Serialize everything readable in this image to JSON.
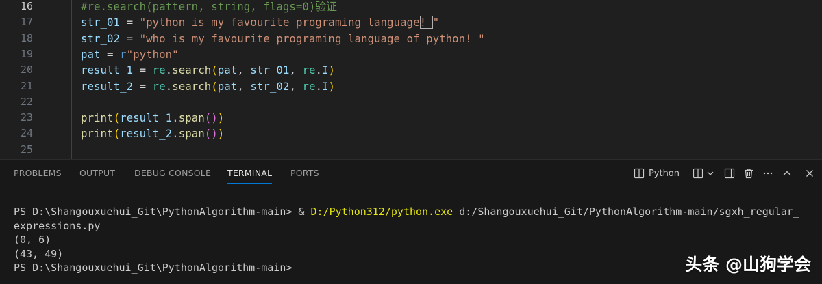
{
  "editor": {
    "lines": [
      {
        "num": "16",
        "active": true,
        "tokens": [
          {
            "t": "#re.search(pattern, string, flags=0)验证",
            "c": "c-com"
          }
        ]
      },
      {
        "num": "17",
        "tokens": [
          {
            "t": "str_01",
            "c": "c-var"
          },
          {
            "t": " = ",
            "c": "c-op"
          },
          {
            "t": "\"python is my favourite programing language",
            "c": "c-str"
          },
          {
            "t": "! ",
            "c": "c-str",
            "box": true
          },
          {
            "t": "\"",
            "c": "c-str"
          }
        ]
      },
      {
        "num": "18",
        "tokens": [
          {
            "t": "str_02",
            "c": "c-var"
          },
          {
            "t": " = ",
            "c": "c-op"
          },
          {
            "t": "\"who is my favourite programing language of python! \"",
            "c": "c-str"
          }
        ]
      },
      {
        "num": "19",
        "tokens": [
          {
            "t": "pat",
            "c": "c-var"
          },
          {
            "t": " = ",
            "c": "c-op"
          },
          {
            "t": "r",
            "c": "c-kw"
          },
          {
            "t": "\"python\"",
            "c": "c-str"
          }
        ]
      },
      {
        "num": "20",
        "tokens": [
          {
            "t": "result_1",
            "c": "c-var"
          },
          {
            "t": " = ",
            "c": "c-op"
          },
          {
            "t": "re",
            "c": "c-mod"
          },
          {
            "t": ".",
            "c": "c-op"
          },
          {
            "t": "search",
            "c": "c-fn"
          },
          {
            "t": "(",
            "c": "c-b3"
          },
          {
            "t": "pat",
            "c": "c-var"
          },
          {
            "t": ", ",
            "c": "c-op"
          },
          {
            "t": "str_01",
            "c": "c-var"
          },
          {
            "t": ", ",
            "c": "c-op"
          },
          {
            "t": "re",
            "c": "c-mod"
          },
          {
            "t": ".",
            "c": "c-op"
          },
          {
            "t": "I",
            "c": "c-var"
          },
          {
            "t": ")",
            "c": "c-b3"
          }
        ]
      },
      {
        "num": "21",
        "tokens": [
          {
            "t": "result_2",
            "c": "c-var"
          },
          {
            "t": " = ",
            "c": "c-op"
          },
          {
            "t": "re",
            "c": "c-mod"
          },
          {
            "t": ".",
            "c": "c-op"
          },
          {
            "t": "search",
            "c": "c-fn"
          },
          {
            "t": "(",
            "c": "c-b3"
          },
          {
            "t": "pat",
            "c": "c-var"
          },
          {
            "t": ", ",
            "c": "c-op"
          },
          {
            "t": "str_02",
            "c": "c-var"
          },
          {
            "t": ", ",
            "c": "c-op"
          },
          {
            "t": "re",
            "c": "c-mod"
          },
          {
            "t": ".",
            "c": "c-op"
          },
          {
            "t": "I",
            "c": "c-var"
          },
          {
            "t": ")",
            "c": "c-b3"
          }
        ]
      },
      {
        "num": "22",
        "tokens": []
      },
      {
        "num": "23",
        "tokens": [
          {
            "t": "print",
            "c": "c-fn"
          },
          {
            "t": "(",
            "c": "c-b3"
          },
          {
            "t": "result_1",
            "c": "c-var"
          },
          {
            "t": ".",
            "c": "c-op"
          },
          {
            "t": "span",
            "c": "c-fn"
          },
          {
            "t": "()",
            "c": "c-b1"
          },
          {
            "t": ")",
            "c": "c-b3"
          }
        ]
      },
      {
        "num": "24",
        "tokens": [
          {
            "t": "print",
            "c": "c-fn"
          },
          {
            "t": "(",
            "c": "c-b3"
          },
          {
            "t": "result_2",
            "c": "c-var"
          },
          {
            "t": ".",
            "c": "c-op"
          },
          {
            "t": "span",
            "c": "c-fn"
          },
          {
            "t": "()",
            "c": "c-b1"
          },
          {
            "t": ")",
            "c": "c-b3"
          }
        ]
      },
      {
        "num": "25",
        "tokens": []
      }
    ]
  },
  "panel": {
    "tabs": {
      "problems": "PROBLEMS",
      "output": "OUTPUT",
      "debug_console": "DEBUG CONSOLE",
      "terminal": "TERMINAL",
      "ports": "PORTS"
    },
    "terminal_name": "Python",
    "accent_color": "#0078d4"
  },
  "terminal": {
    "line1_prompt": "PS D:\\Shangouxuehui_Git\\PythonAlgorithm-main> & ",
    "line1_exe": "D:/Python312/python.exe",
    "line1_arg": " d:/Shangouxuehui_Git/PythonAlgorithm-main/sgxh_regular_",
    "line2": "expressions.py",
    "line3": "(0, 6)",
    "line4": "(43, 49)",
    "line5": "PS D:\\Shangouxuehui_Git\\PythonAlgorithm-main>"
  },
  "watermark": "头条 @山狗学会"
}
